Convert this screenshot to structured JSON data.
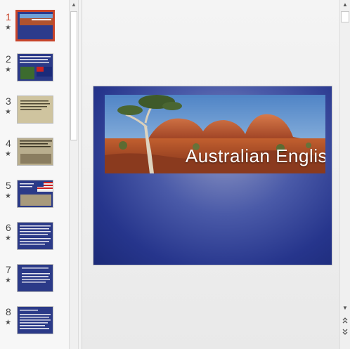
{
  "slides": [
    {
      "number": "1",
      "star": "★",
      "active": true
    },
    {
      "number": "2",
      "star": "★"
    },
    {
      "number": "3",
      "star": "★"
    },
    {
      "number": "4",
      "star": "★"
    },
    {
      "number": "5",
      "star": "★"
    },
    {
      "number": "6",
      "star": "★"
    },
    {
      "number": "7",
      "star": "★"
    },
    {
      "number": "8",
      "star": "★"
    }
  ],
  "current_slide": {
    "title": "Australian English"
  },
  "icons": {
    "scroll_up": "scroll-up-arrow-icon",
    "scroll_down": "scroll-down-arrow-icon",
    "prev_slide": "previous-slide-icon",
    "next_slide": "next-slide-icon"
  },
  "colors": {
    "active_accent": "#c8442a",
    "slide_blue": "#26358c"
  }
}
